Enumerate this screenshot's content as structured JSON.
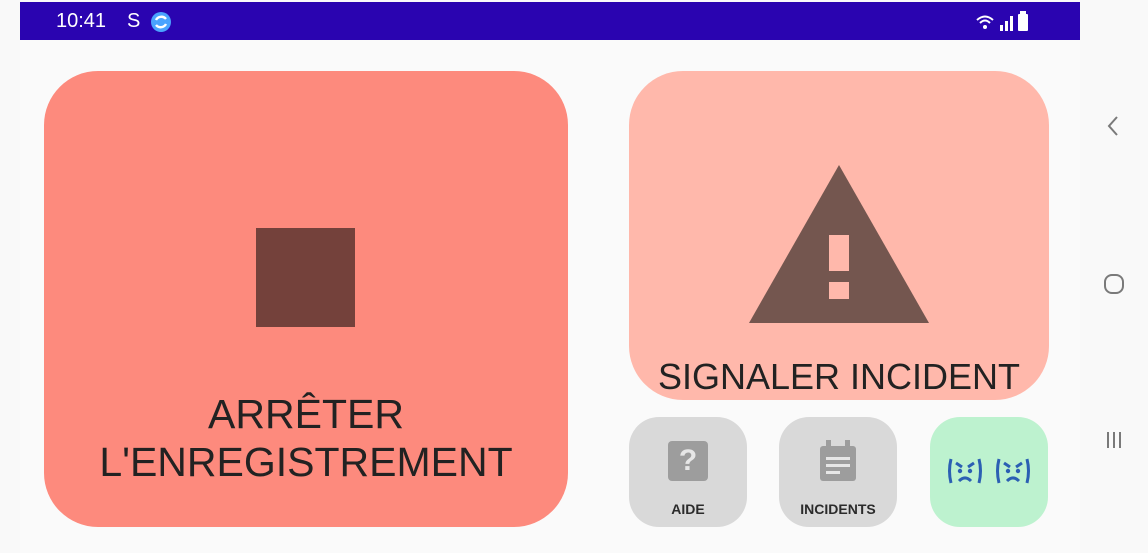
{
  "status_bar": {
    "time": "10:41",
    "s_indicator": "S",
    "sync_icon": "sync-icon",
    "wifi_icon": "wifi-icon",
    "signal_icon": "signal-icon",
    "battery_icon": "battery-icon",
    "color": "#2a04b0"
  },
  "actions": {
    "stop_recording_label": "ARRÊTER\nL'ENREGISTREMENT",
    "report_incident_label": "SIGNALER INCIDENT",
    "help_label": "AIDE",
    "help_glyph": "?",
    "incidents_label": "INCIDENTS"
  },
  "icons": {
    "stop": "stop-icon",
    "warning": "warning-icon",
    "help": "help-icon",
    "calendar": "calendar-icon",
    "angry_face": "angry-face-icon"
  },
  "colors": {
    "stop_tile": "#fd8a7d",
    "incident_tile": "#ffb8ab",
    "grey_tile": "#d9d9d9",
    "mood_tile": "#bdf2cf"
  },
  "nav_bar": {
    "back_icon": "back-icon",
    "home_icon": "home-icon",
    "recents_icon": "recents-icon"
  }
}
